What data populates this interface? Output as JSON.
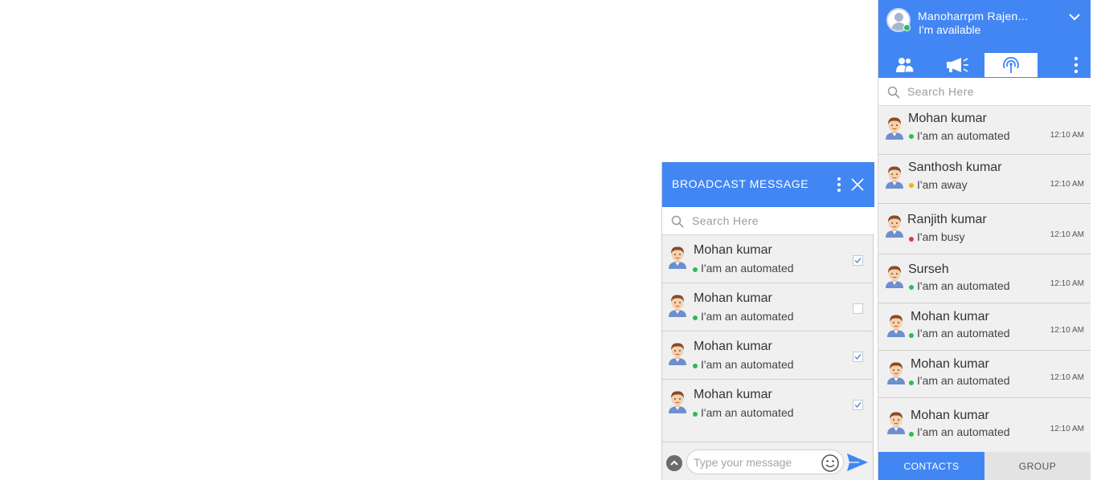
{
  "colors": {
    "accent": "#4286f4",
    "online": "#2dbd4e",
    "away": "#f5b400",
    "busy": "#e53935"
  },
  "profile": {
    "name": "Manoharrpm Rajen...",
    "status": "I'm available"
  },
  "contacts_panel": {
    "tabs": [
      "contacts-icon",
      "broadcast-megaphone-icon",
      "live-broadcast-icon",
      "more-icon"
    ],
    "search_placeholder": "Search Here",
    "contacts": [
      {
        "name": "Mohan kumar",
        "status": "I'am an automated",
        "presence": "online",
        "time": "12:10 AM"
      },
      {
        "name": "Santhosh kumar",
        "status": "I'am away",
        "presence": "away",
        "time": "12:10 AM"
      },
      {
        "name": "Ranjith kumar",
        "status": "I'am busy",
        "presence": "busy",
        "time": "12:10 AM"
      },
      {
        "name": "Surseh",
        "status": "I'am an automated",
        "presence": "online",
        "time": "12:10 AM"
      },
      {
        "name": "Mohan kumar",
        "status": "I'am an automated",
        "presence": "online",
        "time": "12:10 AM"
      },
      {
        "name": "Mohan kumar",
        "status": "I'am an automated",
        "presence": "online",
        "time": "12:10 AM"
      },
      {
        "name": "Mohan kumar",
        "status": "I'am an automated",
        "presence": "online",
        "time": "12:10 AM"
      }
    ],
    "footer": {
      "contacts_label": "CONTACTS",
      "group_label": "GROUP",
      "active": "contacts"
    }
  },
  "broadcast": {
    "title": "BROADCAST MESSAGE",
    "search_placeholder": "Search Here",
    "recipients": [
      {
        "name": "Mohan kumar",
        "status": "I'am an automated",
        "presence": "online",
        "checked": true
      },
      {
        "name": "Mohan kumar",
        "status": "I'am an automated",
        "presence": "online",
        "checked": false
      },
      {
        "name": "Mohan kumar",
        "status": "I'am an automated",
        "presence": "online",
        "checked": true
      },
      {
        "name": "Mohan kumar",
        "status": "I'am an automated",
        "presence": "online",
        "checked": true
      }
    ],
    "compose_placeholder": "Type your message"
  }
}
